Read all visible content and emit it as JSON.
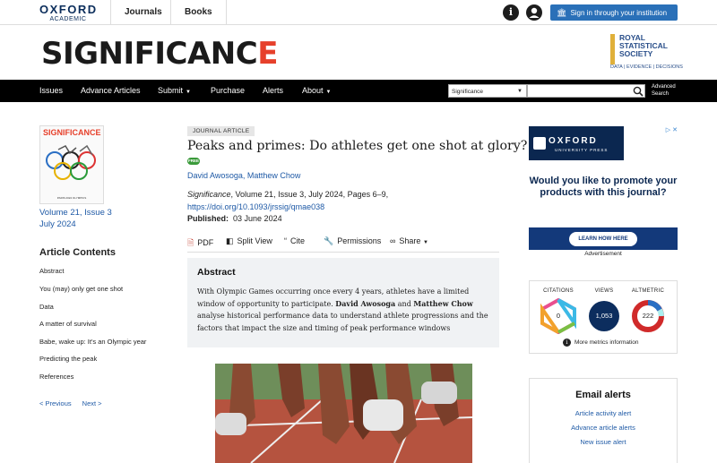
{
  "header": {
    "oxford": "OXFORD",
    "academic": "ACADEMIC",
    "nav": [
      "Journals",
      "Books"
    ],
    "signin": "Sign in through your institution"
  },
  "brand": {
    "name_main": "SIGNIFICANC",
    "name_last": "E",
    "society": [
      "ROYAL",
      "STATISTICAL",
      "SOCIETY"
    ],
    "society_tag": "DATA | EVIDENCE | DECISIONS"
  },
  "mainnav": {
    "items": [
      "Issues",
      "Advance Articles",
      "Submit",
      "Purchase",
      "Alerts",
      "About"
    ],
    "search_scope": "Significance",
    "search_placeholder": "",
    "advanced_search": [
      "Advanced",
      "Search"
    ]
  },
  "sidebar": {
    "cover_title": "SIGNIFICANCE",
    "cover_subtitle": "PARIS 2024 OLYMPICS",
    "volume": "Volume 21, Issue 3",
    "date": "July 2024",
    "contents_heading": "Article Contents",
    "toc": [
      "Abstract",
      "You (may) only get one shot",
      "Data",
      "A matter of survival",
      "Babe, wake up: It's an Olympic year",
      "Predicting the peak",
      "References"
    ],
    "previous": "< Previous",
    "next": "Next >"
  },
  "article": {
    "badge": "JOURNAL ARTICLE",
    "title": "Peaks and primes: Do athletes get one shot at glory?",
    "free": "FREE",
    "authors": "David Awosoga, Matthew Chow",
    "journal": "Significance",
    "citation_rest": ", Volume 21, Issue 3, July 2024, Pages 6–9,",
    "doi": "https://doi.org/10.1093/jrssig/qmae038",
    "published_label": "Published:",
    "published_date": "03 June 2024",
    "tools": [
      "PDF",
      "Split View",
      "Cite",
      "Permissions",
      "Share"
    ],
    "abstract_heading": "Abstract",
    "abstract_pre": "With Olympic Games occurring once every 4 years, athletes have a limited window of opportunity to participate.",
    "abstract_a1": "David Awosoga",
    "abstract_and": "and",
    "abstract_a2": "Matthew Chow",
    "abstract_post": "analyse historical performance data to understand athlete progressions and the factors that impact the size and timing of peak performance windows"
  },
  "ad": {
    "oxford": "OXFORD",
    "press": "UNIVERSITY PRESS",
    "message": "Would you like to promote your products with this journal?",
    "button": "LEARN HOW HERE",
    "label": "Advertisement",
    "close": "▷ ✕"
  },
  "metrics": {
    "labels": [
      "CITATIONS",
      "VIEWS",
      "ALTMETRIC"
    ],
    "citations": "0",
    "views": "1,053",
    "altmetric": "222",
    "more": "More metrics information"
  },
  "alerts": {
    "heading": "Email alerts",
    "links": [
      "Article activity alert",
      "Advance article alerts",
      "New issue alert"
    ]
  },
  "colors": {
    "accent": "#e6402b",
    "link": "#1f5aa6",
    "signin": "#2a70b8",
    "navy": "#0c2d5e"
  }
}
